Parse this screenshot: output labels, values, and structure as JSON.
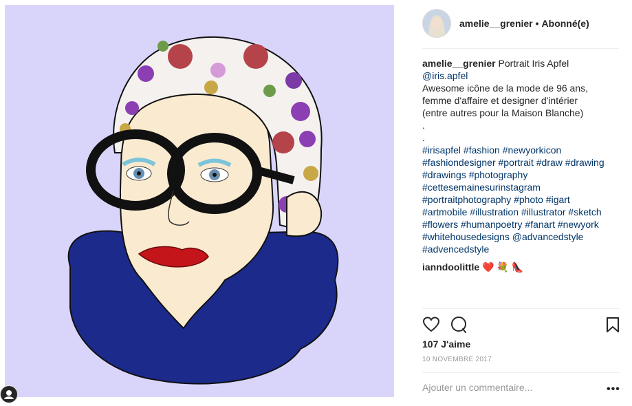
{
  "post": {
    "username": "amelie__grenier",
    "header_dot": "•",
    "follow_status": "Abonné(e)",
    "caption_title": "Portrait Iris Apfel",
    "caption_lines": [
      "@iris.apfel",
      "Awesome icône de la mode de 96 ans,",
      "femme d'affaire et designer d'intérier",
      "(entre autres pour la Maison Blanche)",
      ".",
      ".",
      "#irisapfel #fashion #newyorkicon",
      "#fashiondesigner #portrait #draw #drawing",
      "#drawings #photography",
      "#cettesemainesurinstagram",
      "#portraitphotography #photo #igart",
      "#artmobile #illustration #illustrator #sketch",
      "#flowers #humanpoetry #fanart #newyork",
      "#whitehousedesigns @advancedstyle",
      "#advencedstyle"
    ],
    "comment_user": "ianndoolittle",
    "comment_text": "❤️ 💐 👠",
    "likes": "107 J'aime",
    "date": "10 NOVEMBRE 2017",
    "add_comment_placeholder": "Ajouter un commentaire...",
    "more_label": "•••"
  },
  "icons": [
    "heart-icon",
    "comment-icon",
    "bookmark-icon",
    "user-tag-icon",
    "more-icon"
  ],
  "colors": {
    "art_background": "#d9d5fa",
    "text": "#262626",
    "link": "#003569",
    "muted": "#999999",
    "fur": "#1c2a8c",
    "lips": "#c4151a"
  }
}
